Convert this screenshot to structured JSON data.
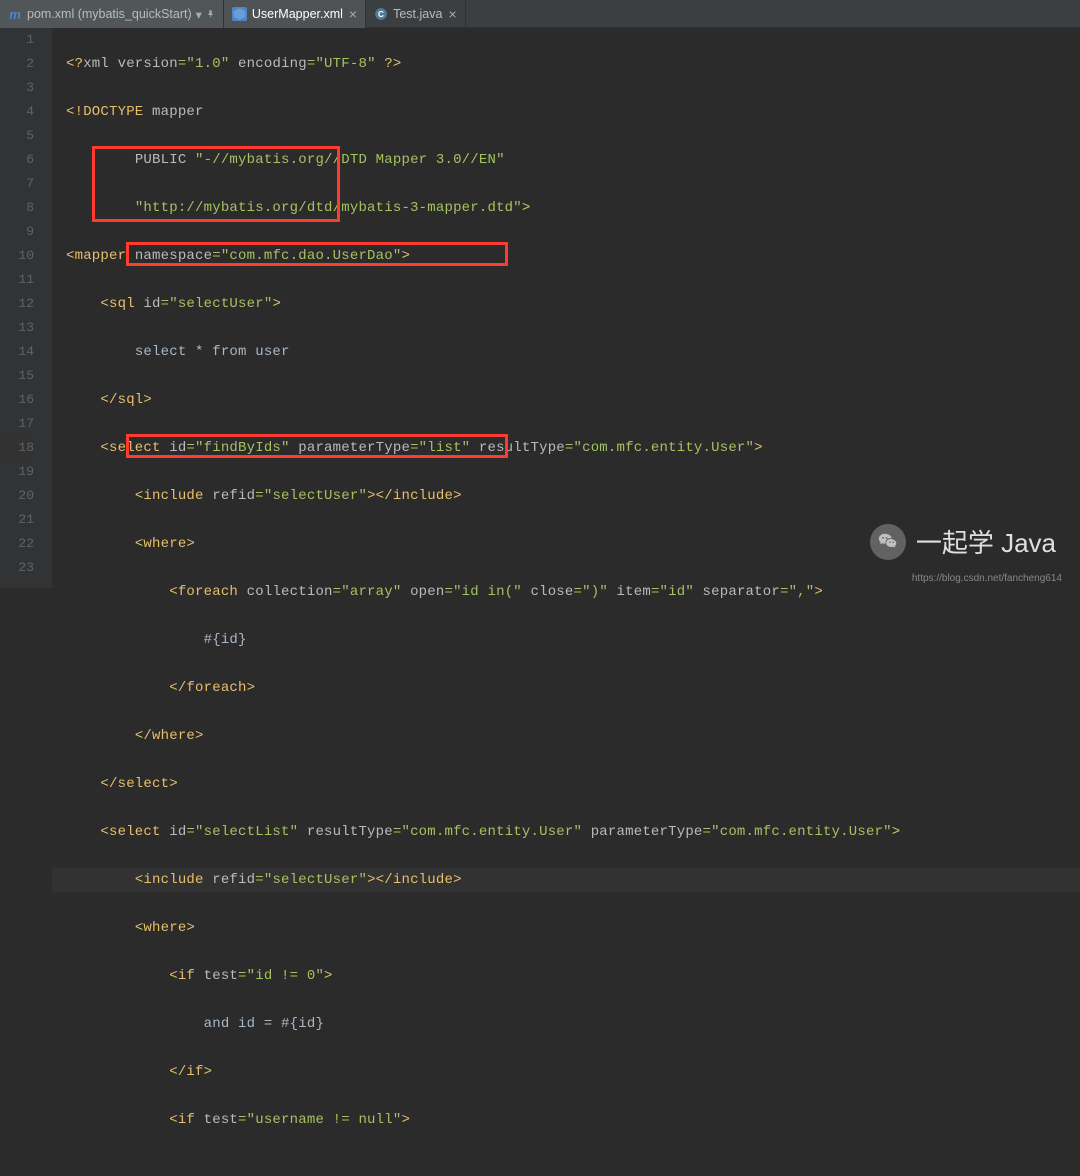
{
  "tabs": [
    {
      "label": "pom.xml (mybatis_quickStart)",
      "icon": "m"
    },
    {
      "label": "UserMapper.xml",
      "icon": "xml"
    },
    {
      "label": "Test.java",
      "icon": "java"
    }
  ],
  "gutter": [
    "1",
    "2",
    "3",
    "4",
    "5",
    "6",
    "7",
    "8",
    "9",
    "10",
    "11",
    "12",
    "13",
    "14",
    "15",
    "16",
    "17",
    "18",
    "19",
    "20",
    "21",
    "22",
    "23"
  ],
  "code": {
    "l1": {
      "p1": "<?",
      "p2": "xml version",
      "p3": "=\"1.0\"",
      "p4": " encoding",
      "p5": "=\"UTF-8\"",
      "p6": " ?>"
    },
    "l2": {
      "p1": "<!",
      "p2": "DOCTYPE ",
      "p3": "mapper"
    },
    "l3": {
      "p1": "PUBLIC ",
      "p2": "\"-//mybatis.org//DTD Mapper 3.0//EN\""
    },
    "l4": {
      "p1": "\"http://mybatis.org/dtd/mybatis-3-mapper.dtd\"",
      "p2": ">"
    },
    "l5": {
      "p1": "<mapper ",
      "p2": "namespace",
      "p3": "=\"com.mfc.dao.UserDao\"",
      "p4": ">"
    },
    "l6": {
      "p1": "<sql ",
      "p2": "id",
      "p3": "=\"selectUser\"",
      "p4": ">"
    },
    "l7": {
      "p1": "select * from user"
    },
    "l8": {
      "p1": "</sql>"
    },
    "l9": {
      "p1": "<select ",
      "p2": "id",
      "p3": "=\"findByIds\"",
      "p4": " parameterType",
      "p5": "=\"list\"",
      "p6": " resultType",
      "p7": "=\"com.mfc.entity.User\"",
      "p8": ">"
    },
    "l10": {
      "p1": "<include ",
      "p2": "refid",
      "p3": "=\"selectUser\"",
      "p4": "></include>"
    },
    "l11": {
      "p1": "<where>"
    },
    "l12": {
      "p1": "<foreach ",
      "p2": "collection",
      "p3": "=\"array\"",
      "p4": " open",
      "p5": "=\"id in(\"",
      "p6": " close",
      "p7": "=\")\"",
      "p8": " item",
      "p9": "=\"id\"",
      "p10": " separator",
      "p11": "=\",\"",
      "p12": ">"
    },
    "l13": {
      "p1": "#{id}"
    },
    "l14": {
      "p1": "</foreach>"
    },
    "l15": {
      "p1": "</where>"
    },
    "l16": {
      "p1": "</select>"
    },
    "l17": {
      "p1": "<select ",
      "p2": "id",
      "p3": "=\"selectList\"",
      "p4": " resultType",
      "p5": "=\"com.mfc.entity.User\"",
      "p6": " parameterType",
      "p7": "=\"com.mfc.entity.User\"",
      "p8": ">"
    },
    "l18": {
      "p1": "<include ",
      "p2": "refid",
      "p3": "=\"selectUser\"",
      "p4": "></include>"
    },
    "l19": {
      "p1": "<where>"
    },
    "l20": {
      "p1": "<if ",
      "p2": "test",
      "p3": "=\"id != 0\"",
      "p4": ">"
    },
    "l21": {
      "p1": "and id = #{id}"
    },
    "l22": {
      "p1": "</if>"
    },
    "l23": {
      "p1": "<if ",
      "p2": "test",
      "p3": "=\"username != null\"",
      "p4": ">"
    }
  },
  "watermark": "一起学 Java",
  "footer_link": "https://blog.csdn.net/fancheng614"
}
